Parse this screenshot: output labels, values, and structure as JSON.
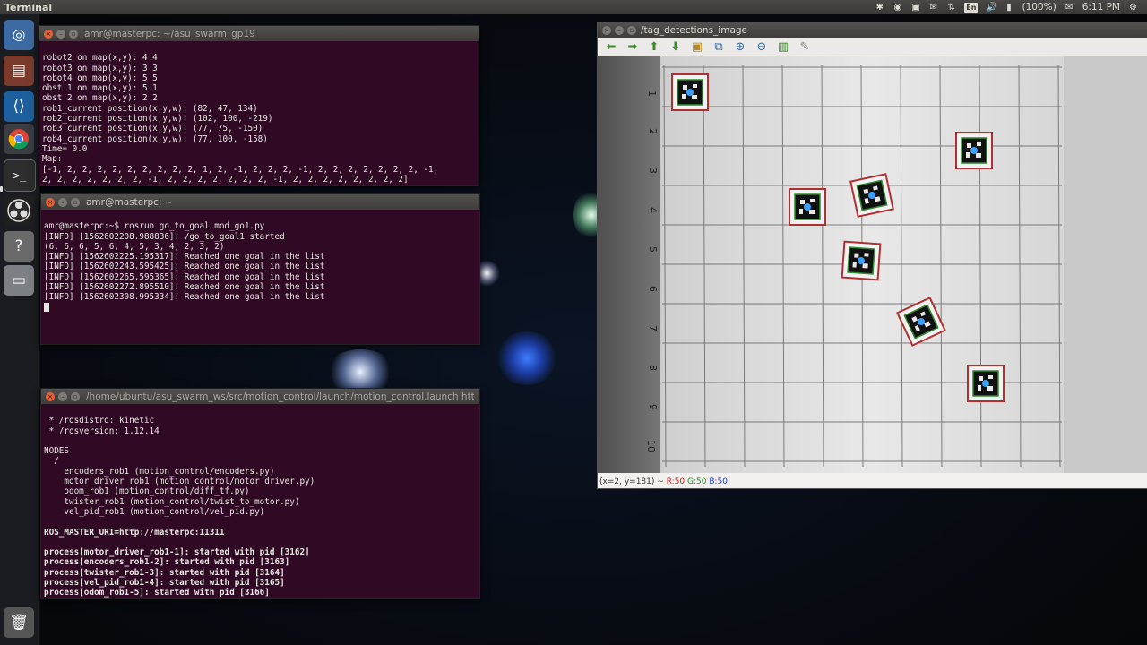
{
  "panel": {
    "app_title": "Terminal",
    "battery": "(100%)",
    "time": "6:11 PM",
    "lang": "En"
  },
  "launcher": {
    "items": [
      "dash-icon",
      "files-icon",
      "vscode-icon",
      "chrome-icon",
      "terminal-icon",
      "obs-icon",
      "help-icon",
      "drive-icon",
      "trash-icon"
    ]
  },
  "terminal1": {
    "title": "amr@masterpc: ~/asu_swarm_gp19",
    "lines": [
      "robot2 on map(x,y): 4 4",
      "robot3 on map(x,y): 3 3",
      "robot4 on map(x,y): 5 5",
      "obst 1 on map(x,y): 5 1",
      "obst 2 on map(x,y): 2 2",
      "rob1_current position(x,y,w): (82, 47, 134)",
      "rob2_current position(x,y,w): (102, 100, -219)",
      "rob3_current position(x,y,w): (77, 75, -150)",
      "rob4_current position(x,y,w): (77, 100, -158)",
      "Time= 0.0",
      "Map:",
      "[-1, 2, 2, 2, 2, 2, 2, 2, 2, 2, 1, 2, -1, 2, 2, 2, -1, 2, 2, 2, 2, 2, 2, 2, -1,",
      "2, 2, 2, 2, 2, 2, 2, -1, 2, 2, 2, 2, 2, 2, 2, -1, 2, 2, 2, 2, 2, 2, 2, 2]"
    ]
  },
  "terminal2": {
    "title": "amr@masterpc: ~",
    "prompt": "amr@masterpc:~$ rosrun go_to_goal mod_go1.py",
    "lines": [
      "[INFO] [1562602208.988836]: /go_to_goal1 started",
      "(6, 6, 6, 5, 6, 4, 5, 3, 4, 2, 3, 2)",
      "[INFO] [1562602225.195317]: Reached one goal in the list",
      "[INFO] [1562602243.595425]: Reached one goal in the list",
      "[INFO] [1562602265.595365]: Reached one goal in the list",
      "[INFO] [1562602272.895510]: Reached one goal in the list",
      "[INFO] [1562602308.995334]: Reached one goal in the list"
    ]
  },
  "terminal3": {
    "title": "/home/ubuntu/asu_swarm_ws/src/motion_control/launch/motion_control.launch http://",
    "lines": [
      " * /rosdistro: kinetic",
      " * /rosversion: 1.12.14",
      "",
      "NODES",
      "  /",
      "    encoders_rob1 (motion_control/encoders.py)",
      "    motor_driver_rob1 (motion_control/motor_driver.py)",
      "    odom_rob1 (motion_control/diff_tf.py)",
      "    twister_rob1 (motion_control/twist_to_motor.py)",
      "    vel_pid_rob1 (motion_control/vel_pid.py)",
      "",
      "ROS_MASTER_URI=http://masterpc:11311",
      "",
      "process[motor_driver_rob1-1]: started with pid [3162]",
      "process[encoders_rob1-2]: started with pid [3163]",
      "process[twister_rob1-3]: started with pid [3164]",
      "process[vel_pid_rob1-4]: started with pid [3165]",
      "process[odom_rob1-5]: started with pid [3166]"
    ]
  },
  "viewer": {
    "title": "/tag_detections_image",
    "row_labels": [
      "1",
      "2",
      "3",
      "4",
      "5",
      "6",
      "7",
      "8",
      "9",
      "10"
    ],
    "status_pos": "(x=2, y=181) ~ ",
    "status_r": "R:50",
    "status_g": "G:50",
    "status_b": "B:50"
  }
}
